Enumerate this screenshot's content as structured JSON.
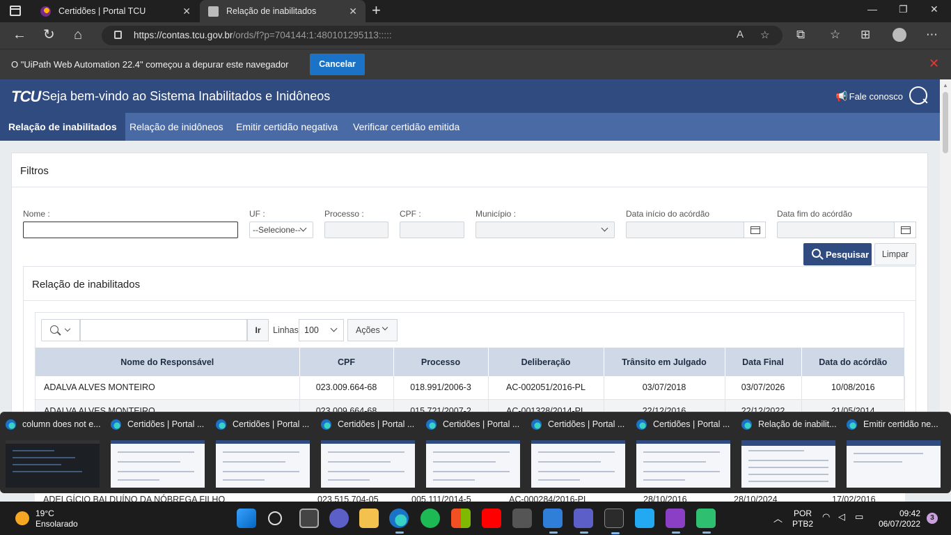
{
  "browser": {
    "tabs": [
      {
        "title": "Certidões | Portal TCU",
        "active": false
      },
      {
        "title": "Relação de inabilitados",
        "active": true
      }
    ],
    "url_host": "https://contas.tcu.gov.br",
    "url_path": "/ords/f?p=704144:1:480101295113:::::",
    "debug_message": "O \"UiPath Web Automation 22.4\" começou a depurar este navegador",
    "debug_button": "Cancelar"
  },
  "site": {
    "logo": "TCU",
    "title": "Seja bem-vindo ao Sistema Inabilitados e Inidôneos",
    "contact": "Fale conosco"
  },
  "menu": [
    {
      "label": "Relação de inabilitados",
      "active": true
    },
    {
      "label": "Relação de inidôneos",
      "active": false
    },
    {
      "label": "Emitir certidão negativa",
      "active": false
    },
    {
      "label": "Verificar certidão emitida",
      "active": false
    }
  ],
  "filters": {
    "title": "Filtros",
    "nome_label": "Nome :",
    "nome_value": "",
    "uf_label": "UF :",
    "uf_value": "--Selecione--",
    "processo_label": "Processo :",
    "cpf_label": "CPF :",
    "municipio_label": "Município :",
    "data_inicio_label": "Data início do acórdão",
    "data_fim_label": "Data fim do acórdão",
    "search_button": "Pesquisar",
    "clear_button": "Limpar"
  },
  "results": {
    "title": "Relação de inabilitados",
    "go_button": "Ir",
    "rows_label": "Linhas",
    "rows_value": "100",
    "actions_button": "Ações",
    "columns": [
      "Nome do Responsável",
      "CPF",
      "Processo",
      "Deliberação",
      "Trânsito em Julgado",
      "Data Final",
      "Data do acórdão"
    ],
    "rows": [
      [
        "ADALVA ALVES MONTEIRO",
        "023.009.664-68",
        "018.991/2006-3",
        "AC-002051/2016-PL",
        "03/07/2018",
        "03/07/2026",
        "10/08/2016"
      ],
      [
        "ADALVA ALVES MONTEIRO",
        "023.009.664-68",
        "015.721/2007-2",
        "AC-001328/2014-PL",
        "22/12/2016",
        "22/12/2022",
        "21/05/2014"
      ]
    ],
    "partial_row": [
      "ADELGÍCIO BALDUÍNO DA NÓBREGA FILHO",
      "023.515.704-05",
      "005.111/2014-5",
      "AC-000284/2016-PL",
      "28/10/2016",
      "28/10/2024",
      "17/02/2016"
    ]
  },
  "thumbnails": [
    {
      "title": "column does not e...",
      "theme": "dark"
    },
    {
      "title": "Certidões | Portal ...",
      "theme": "light"
    },
    {
      "title": "Certidões | Portal ...",
      "theme": "light"
    },
    {
      "title": "Certidões | Portal ...",
      "theme": "light"
    },
    {
      "title": "Certidões | Portal ...",
      "theme": "light"
    },
    {
      "title": "Certidões | Portal ...",
      "theme": "light"
    },
    {
      "title": "Certidões | Portal ...",
      "theme": "light"
    },
    {
      "title": "Relação de inabilit...",
      "theme": "light"
    },
    {
      "title": "Emitir certidão ne...",
      "theme": "light"
    }
  ],
  "taskbar": {
    "temperature": "19°C",
    "weather": "Ensolarado",
    "lang1": "POR",
    "lang2": "PTB2",
    "time": "09:42",
    "date": "06/07/2022",
    "notifications": "3"
  }
}
